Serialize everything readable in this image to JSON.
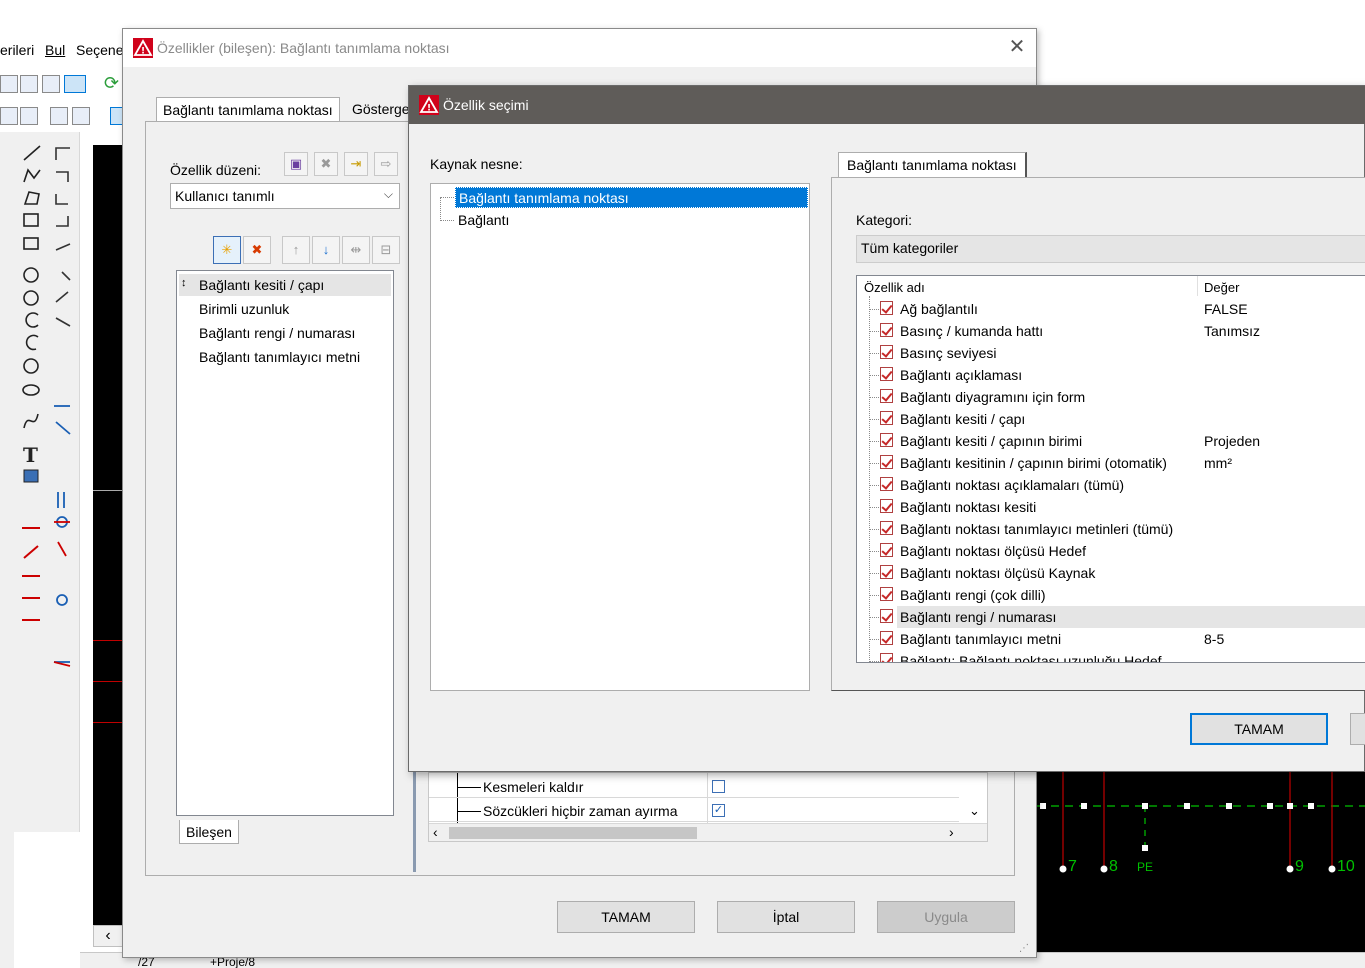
{
  "background": {
    "menu": [
      "erileri",
      "Bul",
      "Seçene"
    ],
    "bottom_tabs": [
      "/27",
      "+Proje/8"
    ]
  },
  "main_dialog": {
    "title": "Özellikler (bileşen): Bağlantı tanımlama noktası",
    "tabs": [
      "Bağlantı tanımlama noktası",
      "Gösterge"
    ],
    "layout_label": "Özellik düzeni:",
    "layout_value": "Kullanıcı tanımlı",
    "property_list": [
      "Bağlantı kesiti / çapı",
      "Birimli uzunluk",
      "Bağlantı rengi / numarası",
      "Bağlantı tanımlayıcı metni"
    ],
    "bottom_tab": "Bileşen",
    "format_rows": [
      {
        "label": "Kesmeleri kaldır",
        "checked": false
      },
      {
        "label": "Sözcükleri hiçbir zaman ayırma",
        "checked": true
      }
    ],
    "buttons": {
      "ok": "TAMAM",
      "cancel": "İptal",
      "apply": "Uygula"
    }
  },
  "select_dialog": {
    "title": "Özellik seçimi",
    "source_label": "Kaynak nesne:",
    "source_items": [
      "Bağlantı tanımlama noktası",
      "Bağlantı"
    ],
    "right_tab": "Bağlantı tanımlama noktası",
    "category_label": "Kategori:",
    "category_value": "Tüm kategoriler",
    "col_name": "Özellik adı",
    "col_value": "Değer",
    "properties": [
      {
        "name": "Ağ bağlantılı",
        "value": "FALSE"
      },
      {
        "name": "Basınç / kumanda hattı",
        "value": "Tanımsız"
      },
      {
        "name": "Basınç seviyesi",
        "value": ""
      },
      {
        "name": "Bağlantı açıklaması",
        "value": ""
      },
      {
        "name": "Bağlantı diyagramını için form",
        "value": ""
      },
      {
        "name": "Bağlantı kesiti / çapı",
        "value": ""
      },
      {
        "name": "Bağlantı kesiti / çapının birimi",
        "value": "Projeden"
      },
      {
        "name": "Bağlantı kesitinin / çapının birimi (otomatik)",
        "value": "mm²"
      },
      {
        "name": "Bağlantı noktası açıklamaları (tümü)",
        "value": ""
      },
      {
        "name": "Bağlantı noktası kesiti",
        "value": ""
      },
      {
        "name": "Bağlantı noktası tanımlayıcı metinleri (tümü)",
        "value": ""
      },
      {
        "name": "Bağlantı noktası ölçüsü Hedef",
        "value": ""
      },
      {
        "name": "Bağlantı noktası ölçüsü Kaynak",
        "value": ""
      },
      {
        "name": "Bağlantı rengi (çok dilli)",
        "value": ""
      },
      {
        "name": "Bağlantı rengi / numarası",
        "value": ""
      },
      {
        "name": "Bağlantı tanımlayıcı metni",
        "value": "8-5"
      },
      {
        "name": "Bağlantı: Bağlantı noktası uzunluğu Hedef",
        "value": ""
      }
    ],
    "ok": "TAMAM"
  },
  "canvas_labels": [
    "7",
    "8",
    "PE",
    "9",
    "10"
  ],
  "colors": {
    "accent": "#0078d7",
    "selection": "#0078d7",
    "title_dark": "#5f5c59",
    "wire": "#c00000",
    "terminal": "#00c000"
  }
}
